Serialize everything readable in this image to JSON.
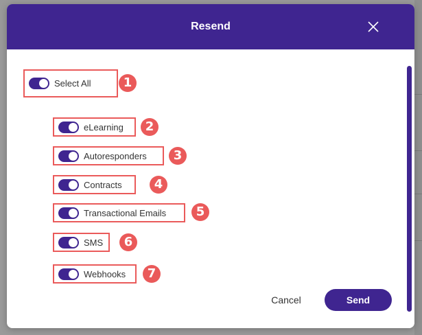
{
  "dialog": {
    "title": "Resend",
    "close_icon": "close-icon"
  },
  "toggles": {
    "select_all": {
      "label": "Select All",
      "on": true,
      "badge": "1"
    },
    "elearning": {
      "label": "eLearning",
      "on": true,
      "badge": "2"
    },
    "autoresponders": {
      "label": "Autoresponders",
      "on": true,
      "badge": "3"
    },
    "contracts": {
      "label": "Contracts",
      "on": true,
      "badge": "4"
    },
    "transactional": {
      "label": "Transactional Emails",
      "on": true,
      "badge": "5"
    },
    "sms": {
      "label": "SMS",
      "on": true,
      "badge": "6"
    },
    "webhooks": {
      "label": "Webhooks",
      "on": true,
      "badge": "7"
    }
  },
  "footer": {
    "cancel_label": "Cancel",
    "send_label": "Send"
  },
  "colors": {
    "brand": "#3f2590",
    "annotation": "#ea5a5a"
  }
}
